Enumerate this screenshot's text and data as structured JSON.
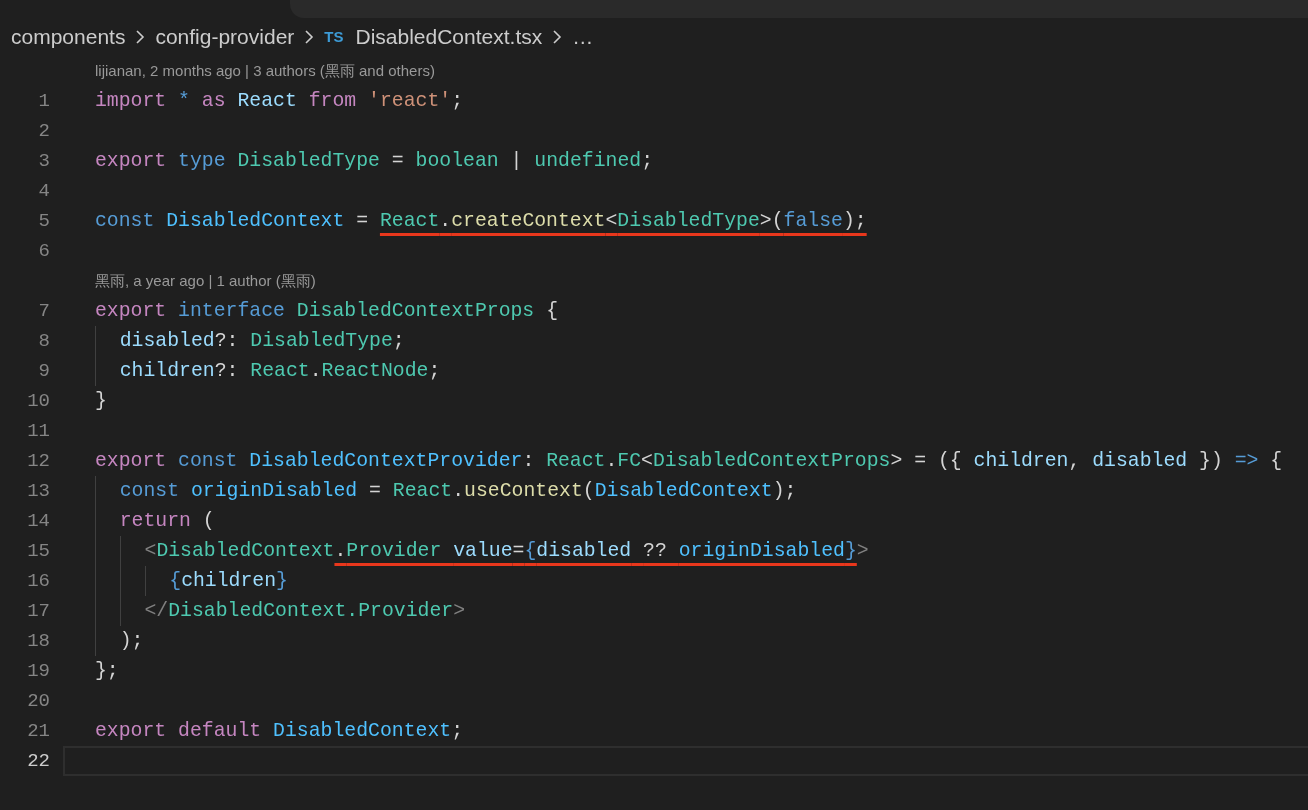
{
  "breadcrumb": [
    {
      "kind": "folder",
      "label": "components"
    },
    {
      "kind": "folder",
      "label": "config-provider"
    },
    {
      "kind": "file",
      "icon_text": "TS",
      "label": "DisabledContext.tsx"
    },
    {
      "kind": "more",
      "label": "…"
    }
  ],
  "lines": [
    {
      "number": "1",
      "current": false,
      "annotation": "lijianan, 2 months ago | 3 authors (黑雨 and others)",
      "tokens": [
        {
          "kind": "kw",
          "text": "import "
        },
        {
          "kind": "storage",
          "text": "* "
        },
        {
          "kind": "kw",
          "text": "as "
        },
        {
          "kind": "var",
          "text": "React "
        },
        {
          "kind": "kw",
          "text": "from "
        },
        {
          "kind": "str",
          "text": "'react'"
        },
        {
          "kind": "punct",
          "text": ";"
        }
      ]
    },
    {
      "number": "2",
      "current": false
    },
    {
      "number": "3",
      "current": false,
      "tokens": [
        {
          "kind": "kw",
          "text": "export "
        },
        {
          "kind": "storage",
          "text": "type "
        },
        {
          "kind": "type",
          "text": "DisabledType"
        },
        {
          "kind": "punct",
          "text": " = "
        },
        {
          "kind": "type",
          "text": "boolean"
        },
        {
          "kind": "punct",
          "text": " | "
        },
        {
          "kind": "type",
          "text": "undefined"
        },
        {
          "kind": "punct",
          "text": ";"
        }
      ]
    },
    {
      "number": "4",
      "current": false
    },
    {
      "number": "5",
      "current": false,
      "tokens": [
        {
          "kind": "storage",
          "text": "const "
        },
        {
          "kind": "const",
          "text": "DisabledContext"
        },
        {
          "kind": "punct",
          "text": " = "
        },
        {
          "kind": "underlined",
          "tokens": [
            {
              "kind": "type",
              "text": "React"
            },
            {
              "kind": "punct",
              "text": "."
            },
            {
              "kind": "fn",
              "text": "createContext"
            },
            {
              "kind": "punct",
              "text": "<"
            },
            {
              "kind": "type",
              "text": "DisabledType"
            },
            {
              "kind": "punct",
              "text": ">("
            },
            {
              "kind": "storage",
              "text": "false"
            },
            {
              "kind": "punct",
              "text": ");"
            }
          ]
        }
      ]
    },
    {
      "number": "6",
      "current": false
    },
    {
      "number": "7",
      "current": false,
      "annotation": "黑雨, a year ago | 1 author (黑雨)",
      "tokens": [
        {
          "kind": "kw",
          "text": "export "
        },
        {
          "kind": "storage",
          "text": "interface "
        },
        {
          "kind": "type",
          "text": "DisabledContextProps"
        },
        {
          "kind": "punct",
          "text": " {"
        }
      ]
    },
    {
      "number": "8",
      "current": false,
      "tokens": [
        {
          "kind": "var",
          "text": "  disabled"
        },
        {
          "kind": "punct",
          "text": "?: "
        },
        {
          "kind": "type",
          "text": "DisabledType"
        },
        {
          "kind": "punct",
          "text": ";"
        }
      ]
    },
    {
      "number": "9",
      "current": false,
      "tokens": [
        {
          "kind": "var",
          "text": "  children"
        },
        {
          "kind": "punct",
          "text": "?: "
        },
        {
          "kind": "type",
          "text": "React"
        },
        {
          "kind": "punct",
          "text": "."
        },
        {
          "kind": "type",
          "text": "ReactNode"
        },
        {
          "kind": "punct",
          "text": ";"
        }
      ]
    },
    {
      "number": "10",
      "current": false,
      "tokens": [
        {
          "kind": "punct",
          "text": "}"
        }
      ]
    },
    {
      "number": "11",
      "current": false
    },
    {
      "number": "12",
      "current": false,
      "tokens": [
        {
          "kind": "kw",
          "text": "export "
        },
        {
          "kind": "storage",
          "text": "const "
        },
        {
          "kind": "const",
          "text": "DisabledContextProvider"
        },
        {
          "kind": "punct",
          "text": ": "
        },
        {
          "kind": "type",
          "text": "React"
        },
        {
          "kind": "punct",
          "text": "."
        },
        {
          "kind": "type",
          "text": "FC"
        },
        {
          "kind": "punct",
          "text": "<"
        },
        {
          "kind": "type",
          "text": "DisabledContextProps"
        },
        {
          "kind": "punct",
          "text": "> = ({ "
        },
        {
          "kind": "var",
          "text": "children"
        },
        {
          "kind": "punct",
          "text": ", "
        },
        {
          "kind": "var",
          "text": "disabled"
        },
        {
          "kind": "punct",
          "text": " }) "
        },
        {
          "kind": "storage",
          "text": "=>"
        },
        {
          "kind": "punct",
          "text": " {"
        }
      ]
    },
    {
      "number": "13",
      "current": false,
      "tokens": [
        {
          "kind": "storage",
          "text": "  const "
        },
        {
          "kind": "const",
          "text": "originDisabled"
        },
        {
          "kind": "punct",
          "text": " = "
        },
        {
          "kind": "type",
          "text": "React"
        },
        {
          "kind": "punct",
          "text": "."
        },
        {
          "kind": "fn",
          "text": "useContext"
        },
        {
          "kind": "punct",
          "text": "("
        },
        {
          "kind": "const",
          "text": "DisabledContext"
        },
        {
          "kind": "punct",
          "text": ");"
        }
      ]
    },
    {
      "number": "14",
      "current": false,
      "tokens": [
        {
          "kind": "kw",
          "text": "  return"
        },
        {
          "kind": "punct",
          "text": " ("
        }
      ]
    },
    {
      "number": "15",
      "current": false,
      "tokens": [
        {
          "kind": "tag",
          "text": "    <"
        },
        {
          "kind": "type",
          "text": "DisabledContext"
        },
        {
          "kind": "underlined",
          "tokens": [
            {
              "kind": "punct",
              "text": "."
            },
            {
              "kind": "type",
              "text": "Provider "
            },
            {
              "kind": "var",
              "text": "value"
            },
            {
              "kind": "punct",
              "text": "="
            },
            {
              "kind": "storage",
              "text": "{"
            },
            {
              "kind": "var",
              "text": "disabled"
            },
            {
              "kind": "punct",
              "text": " ?? "
            },
            {
              "kind": "const",
              "text": "originDisabled"
            },
            {
              "kind": "storage",
              "text": "}"
            }
          ]
        },
        {
          "kind": "tag",
          "text": ">"
        }
      ]
    },
    {
      "number": "16",
      "current": false,
      "tokens": [
        {
          "kind": "storage",
          "text": "      {"
        },
        {
          "kind": "var",
          "text": "children"
        },
        {
          "kind": "storage",
          "text": "}"
        }
      ]
    },
    {
      "number": "17",
      "current": false,
      "tokens": [
        {
          "kind": "tag",
          "text": "    </"
        },
        {
          "kind": "type",
          "text": "DisabledContext.Provider"
        },
        {
          "kind": "tag",
          "text": ">"
        }
      ]
    },
    {
      "number": "18",
      "current": false,
      "tokens": [
        {
          "kind": "punct",
          "text": "  );"
        }
      ]
    },
    {
      "number": "19",
      "current": false,
      "tokens": [
        {
          "kind": "punct",
          "text": "};"
        }
      ]
    },
    {
      "number": "20",
      "current": false
    },
    {
      "number": "21",
      "current": false,
      "tokens": [
        {
          "kind": "kw",
          "text": "export "
        },
        {
          "kind": "kw",
          "text": "default "
        },
        {
          "kind": "const",
          "text": "DisabledContext"
        },
        {
          "kind": "punct",
          "text": ";"
        }
      ]
    },
    {
      "number": "22",
      "current": true
    }
  ]
}
